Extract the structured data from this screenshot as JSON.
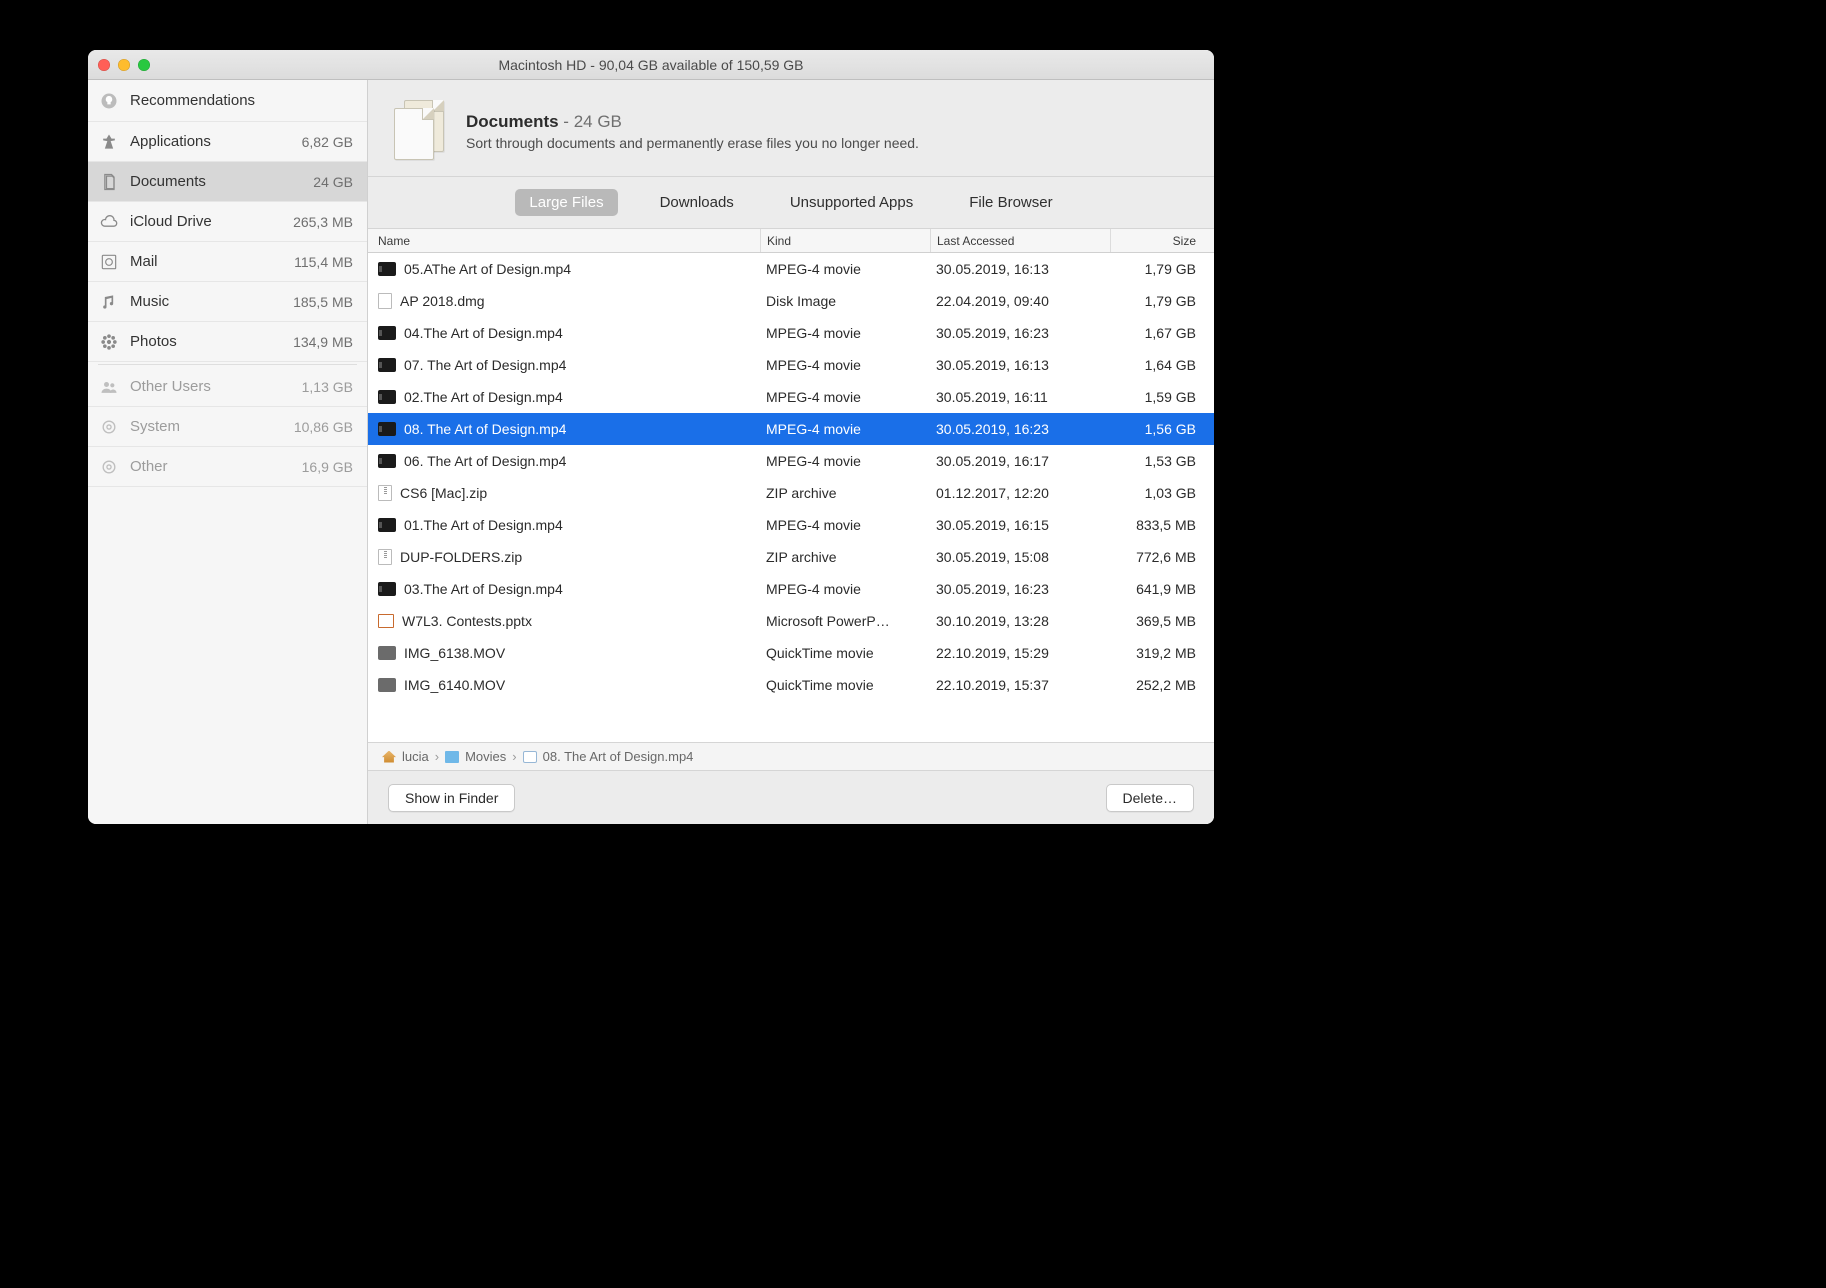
{
  "window_title": "Macintosh HD - 90,04 GB available of 150,59 GB",
  "sidebar": {
    "items": [
      {
        "label": "Recommendations",
        "size": "",
        "icon": "lightbulb-icon",
        "dim": false
      },
      {
        "label": "Applications",
        "size": "6,82 GB",
        "icon": "apps-icon",
        "dim": false
      },
      {
        "label": "Documents",
        "size": "24 GB",
        "icon": "documents-icon",
        "dim": false,
        "selected": true
      },
      {
        "label": "iCloud Drive",
        "size": "265,3 MB",
        "icon": "cloud-icon",
        "dim": false
      },
      {
        "label": "Mail",
        "size": "115,4 MB",
        "icon": "stamp-icon",
        "dim": false
      },
      {
        "label": "Music",
        "size": "185,5 MB",
        "icon": "music-icon",
        "dim": false
      },
      {
        "label": "Photos",
        "size": "134,9 MB",
        "icon": "flower-icon",
        "dim": false
      },
      {
        "label": "Other Users",
        "size": "1,13 GB",
        "icon": "users-icon",
        "dim": true
      },
      {
        "label": "System",
        "size": "10,86 GB",
        "icon": "gear-icon",
        "dim": true
      },
      {
        "label": "Other",
        "size": "16,9 GB",
        "icon": "gear-icon",
        "dim": true
      }
    ]
  },
  "header": {
    "title": "Documents",
    "sep": " - ",
    "size": "24 GB",
    "subtitle": "Sort through documents and permanently erase files you no longer need."
  },
  "tabs": [
    {
      "label": "Large Files",
      "active": true
    },
    {
      "label": "Downloads",
      "active": false
    },
    {
      "label": "Unsupported Apps",
      "active": false
    },
    {
      "label": "File Browser",
      "active": false
    }
  ],
  "columns": {
    "name": "Name",
    "kind": "Kind",
    "date": "Last Accessed",
    "size": "Size"
  },
  "files": [
    {
      "icon": "video",
      "name": "05.AThe Art of Design.mp4",
      "kind": "MPEG-4 movie",
      "date": "30.05.2019, 16:13",
      "size": "1,79 GB"
    },
    {
      "icon": "dmg",
      "name": "AP 2018.dmg",
      "kind": "Disk Image",
      "date": "22.04.2019, 09:40",
      "size": "1,79 GB"
    },
    {
      "icon": "video",
      "name": "04.The Art of Design.mp4",
      "kind": "MPEG-4 movie",
      "date": "30.05.2019, 16:23",
      "size": "1,67 GB"
    },
    {
      "icon": "video",
      "name": "07. The Art of Design.mp4",
      "kind": "MPEG-4 movie",
      "date": "30.05.2019, 16:13",
      "size": "1,64 GB"
    },
    {
      "icon": "video",
      "name": "02.The Art of Design.mp4",
      "kind": "MPEG-4 movie",
      "date": "30.05.2019, 16:11",
      "size": "1,59 GB"
    },
    {
      "icon": "video",
      "name": "08. The Art of Design.mp4",
      "kind": "MPEG-4 movie",
      "date": "30.05.2019, 16:23",
      "size": "1,56 GB",
      "selected": true
    },
    {
      "icon": "video",
      "name": "06. The Art of Design.mp4",
      "kind": "MPEG-4 movie",
      "date": "30.05.2019, 16:17",
      "size": "1,53 GB"
    },
    {
      "icon": "zip",
      "name": "CS6 [Mac].zip",
      "kind": "ZIP archive",
      "date": "01.12.2017, 12:20",
      "size": "1,03 GB"
    },
    {
      "icon": "video",
      "name": "01.The Art of Design.mp4",
      "kind": "MPEG-4 movie",
      "date": "30.05.2019, 16:15",
      "size": "833,5 MB"
    },
    {
      "icon": "zip",
      "name": "DUP-FOLDERS.zip",
      "kind": "ZIP archive",
      "date": "30.05.2019, 15:08",
      "size": "772,6 MB"
    },
    {
      "icon": "video",
      "name": "03.The Art of Design.mp4",
      "kind": "MPEG-4 movie",
      "date": "30.05.2019, 16:23",
      "size": "641,9 MB"
    },
    {
      "icon": "ppt",
      "name": "W7L3. Contests.pptx",
      "kind": "Microsoft PowerP…",
      "date": "30.10.2019, 13:28",
      "size": "369,5 MB"
    },
    {
      "icon": "mov",
      "name": "IMG_6138.MOV",
      "kind": "QuickTime movie",
      "date": "22.10.2019, 15:29",
      "size": "319,2 MB"
    },
    {
      "icon": "mov",
      "name": "IMG_6140.MOV",
      "kind": "QuickTime movie",
      "date": "22.10.2019, 15:37",
      "size": "252,2 MB"
    }
  ],
  "path": [
    {
      "icon": "home",
      "label": "lucia"
    },
    {
      "icon": "folder",
      "label": "Movies"
    },
    {
      "icon": "qt",
      "label": "08. The Art of Design.mp4"
    }
  ],
  "chev": "›",
  "buttons": {
    "show_in_finder": "Show in Finder",
    "delete": "Delete…"
  }
}
